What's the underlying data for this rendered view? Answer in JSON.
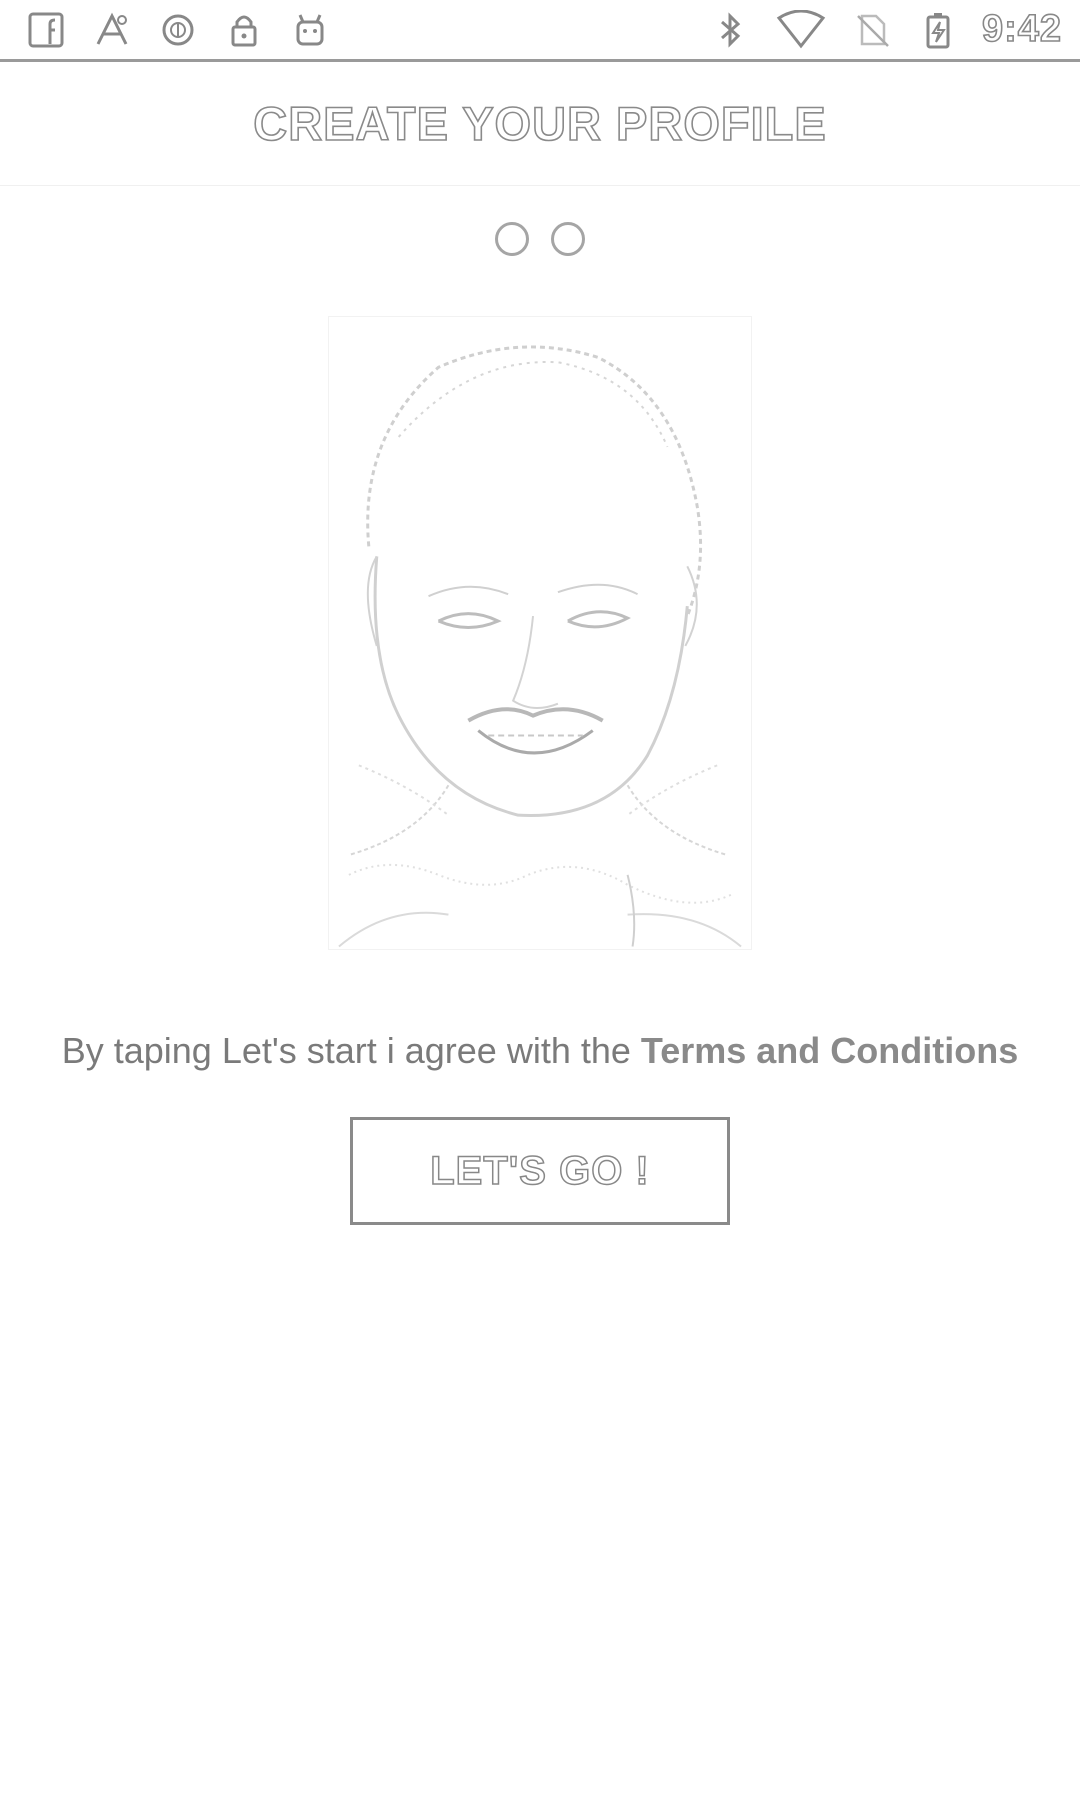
{
  "status_bar": {
    "left_icons": [
      "facebook-icon",
      "app-icon",
      "circle-icon",
      "lock-icon",
      "android-icon"
    ],
    "right_icons": [
      "bluetooth-icon",
      "wifi-icon",
      "no-sim-icon",
      "battery-charging-icon"
    ],
    "time": "9:42"
  },
  "header": {
    "title": "CREATE YOUR PROFILE"
  },
  "pager": {
    "page_count": 2
  },
  "main": {
    "terms_prefix": "By taping Let's start i agree with the ",
    "terms_link": "Terms and Conditions",
    "button_label": "LET'S GO !"
  },
  "colors": {
    "background": "#ffffff",
    "text": "#7a7a7a",
    "outline": "#8a8a8a"
  }
}
